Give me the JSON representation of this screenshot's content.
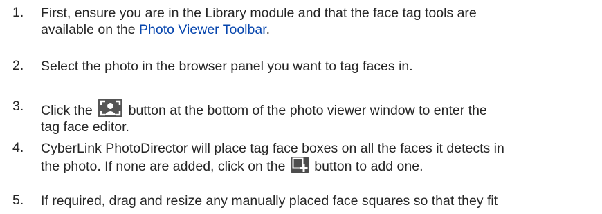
{
  "steps": [
    {
      "number": "1.",
      "line1": "First, ensure you are in the Library module and that the face tag tools are",
      "line2_prefix": "available on the ",
      "link_text": "Photo Viewer Toolbar",
      "line2_suffix": "."
    },
    {
      "number": "2.",
      "text": "Select the photo in the browser panel you want to tag faces in."
    },
    {
      "number": "3.",
      "before_icon": "Click the ",
      "icon": "tag-face-icon",
      "after_icon": " button at the bottom of the photo viewer window to enter the",
      "line2": "tag face editor."
    },
    {
      "number": "4.",
      "line1": "CyberLink PhotoDirector will place tag face boxes on all the faces it detects in",
      "before_icon": "the photo. If none are added, click on the ",
      "icon": "add-face-box-icon",
      "after_icon": " button to add one."
    },
    {
      "number": "5.",
      "text": "If required, drag and resize any manually placed face squares so that they fit"
    }
  ],
  "colors": {
    "text": "#262626",
    "link": "#0645ad",
    "icon_background": "#555555"
  }
}
